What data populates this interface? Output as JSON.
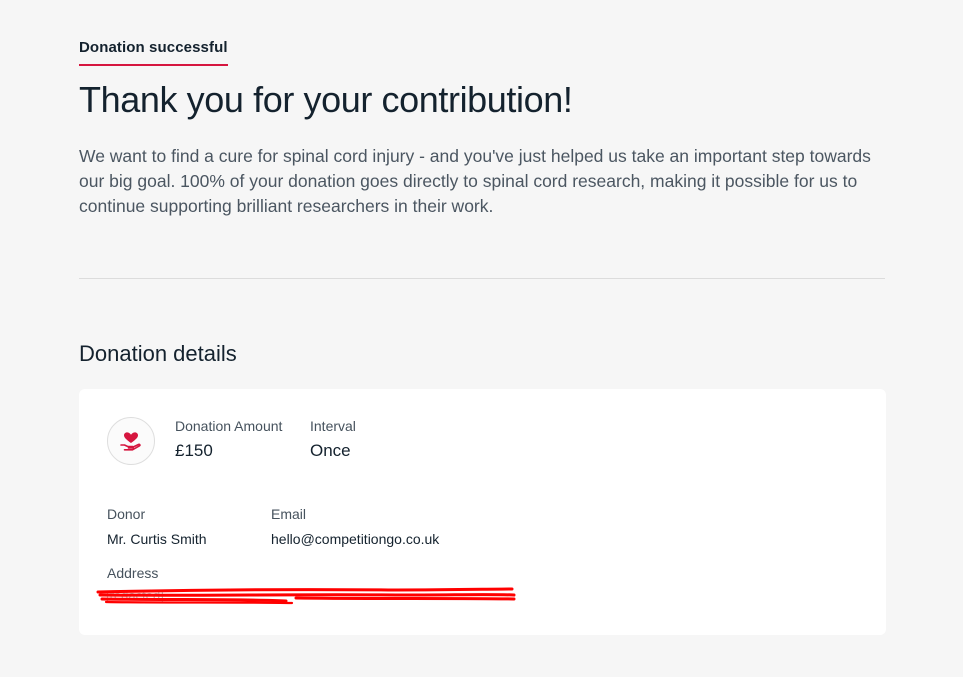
{
  "header": {
    "status": "Donation successful",
    "title": "Thank you for your contribution!",
    "intro": "We want to find a cure for spinal cord injury - and you've just helped us take an important step towards our big goal. 100% of your donation goes directly to spinal cord research, making it possible for us to continue supporting brilliant researchers in their work."
  },
  "details": {
    "section_title": "Donation details",
    "icon": "heart-in-hand-icon",
    "amount_label": "Donation Amount",
    "amount_value": "£150",
    "interval_label": "Interval",
    "interval_value": "Once",
    "donor_label": "Donor",
    "donor_value": "Mr. Curtis Smith",
    "email_label": "Email",
    "email_value": "hello@competitiongo.co.uk",
    "address_label": "Address",
    "address_value": "[redacted]"
  },
  "colors": {
    "accent": "#d6163f",
    "redaction": "#ff0000",
    "background": "#f6f6f6",
    "card": "#ffffff"
  }
}
